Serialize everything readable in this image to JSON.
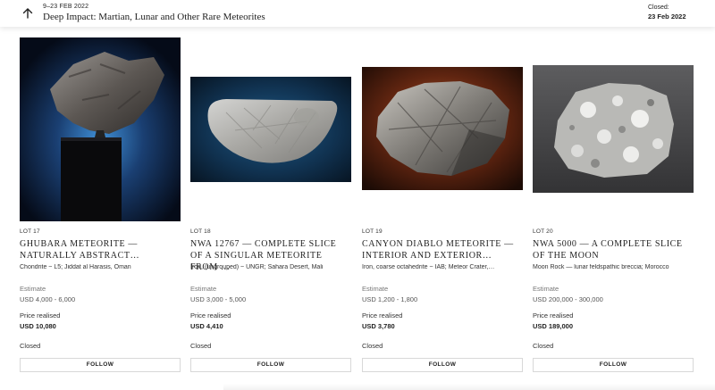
{
  "header": {
    "dates": "9–23 FEB 2022",
    "title": "Deep Impact: Martian, Lunar and Other Rare Meteorites",
    "closed_label": "Closed:",
    "closed_date": "23 Feb 2022",
    "back_icon": "arrow-up-icon"
  },
  "lots": [
    {
      "lot": "LOT 17",
      "title": "GHUBARA METEORITE — NATURALLY ABSTRACT…",
      "description": "Chondrite ~ L5; Jiddat al Harasis, Oman",
      "estimate_label": "Estimate",
      "estimate": "USD 4,000 - 6,000",
      "price_label": "Price realised",
      "price": "USD 10,080",
      "status": "Closed",
      "follow": "FOLLOW"
    },
    {
      "lot": "LOT 18",
      "title": "NWA 12767 — COMPLETE SLICE OF A SINGULAR METEORITE FROM …",
      "description": "Iron, (ungrouped) ~ UNGR; Sahara Desert, Mali",
      "estimate_label": "Estimate",
      "estimate": "USD 3,000 - 5,000",
      "price_label": "Price realised",
      "price": "USD 4,410",
      "status": "Closed",
      "follow": "FOLLOW"
    },
    {
      "lot": "LOT 19",
      "title": "CANYON DIABLO METEORITE — INTERIOR AND EXTERIOR…",
      "description": "Iron, coarse octahedrite ~ IAB; Meteor Crater,…",
      "estimate_label": "Estimate",
      "estimate": "USD 1,200 - 1,800",
      "price_label": "Price realised",
      "price": "USD 3,780",
      "status": "Closed",
      "follow": "FOLLOW"
    },
    {
      "lot": "LOT 20",
      "title": "NWA 5000 — A COMPLETE SLICE OF THE MOON",
      "description": "Moon Rock — lunar feldspathic breccia; Morocco",
      "estimate_label": "Estimate",
      "estimate": "USD 200,000 - 300,000",
      "price_label": "Price realised",
      "price": "USD 189,000",
      "status": "Closed",
      "follow": "FOLLOW"
    }
  ]
}
